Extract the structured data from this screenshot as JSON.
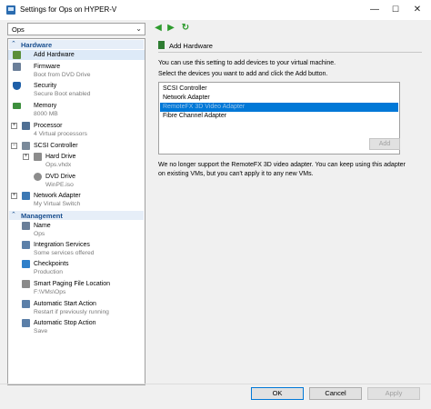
{
  "window": {
    "title": "Settings for Ops on HYPER-V",
    "minimize": "—",
    "maximize": "☐",
    "close": "✕"
  },
  "vm_selector": {
    "value": "Ops"
  },
  "sidebar": {
    "hardware_header": "Hardware",
    "management_header": "Management",
    "hardware_items": [
      {
        "name": "Add Hardware",
        "sub": ""
      },
      {
        "name": "Firmware",
        "sub": "Boot from DVD Drive"
      },
      {
        "name": "Security",
        "sub": "Secure Boot enabled"
      },
      {
        "name": "Memory",
        "sub": "8000 MB"
      },
      {
        "name": "Processor",
        "sub": "4 Virtual processors"
      },
      {
        "name": "SCSI Controller",
        "sub": ""
      },
      {
        "name": "Hard Drive",
        "sub": "Ops.vhdx"
      },
      {
        "name": "DVD Drive",
        "sub": "WinPE.iso"
      },
      {
        "name": "Network Adapter",
        "sub": "My Virtual Switch"
      }
    ],
    "management_items": [
      {
        "name": "Name",
        "sub": "Ops"
      },
      {
        "name": "Integration Services",
        "sub": "Some services offered"
      },
      {
        "name": "Checkpoints",
        "sub": "Production"
      },
      {
        "name": "Smart Paging File Location",
        "sub": "F:\\VMs\\Ops"
      },
      {
        "name": "Automatic Start Action",
        "sub": "Restart if previously running"
      },
      {
        "name": "Automatic Stop Action",
        "sub": "Save"
      }
    ]
  },
  "content": {
    "title": "Add Hardware",
    "desc1": "You can use this setting to add devices to your virtual machine.",
    "desc2": "Select the devices you want to add and click the Add button.",
    "devices": [
      "SCSI Controller",
      "Network Adapter",
      "RemoteFX 3D Video Adapter",
      "Fibre Channel Adapter"
    ],
    "add_label": "Add",
    "note": "We no longer support the RemoteFX 3D video adapter. You can keep using this adapter on existing VMs, but you can't apply it to any new VMs."
  },
  "footer": {
    "ok": "OK",
    "cancel": "Cancel",
    "apply": "Apply"
  },
  "colors": {
    "accent": "#0078d7",
    "header_blue": "#1a4f8f"
  }
}
